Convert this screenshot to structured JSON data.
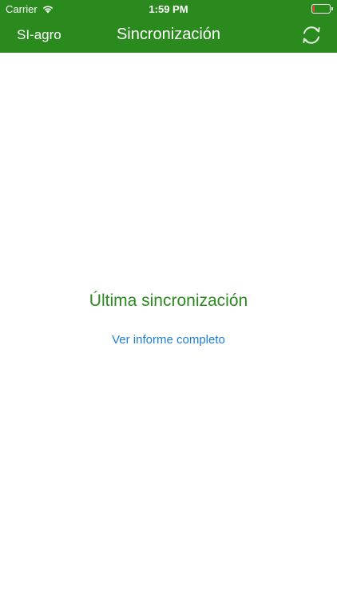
{
  "status_bar": {
    "carrier": "Carrier",
    "time": "1:59 PM",
    "battery_level_percent": 12,
    "wifi_icon": "wifi-icon",
    "battery_icon": "battery-icon"
  },
  "nav_bar": {
    "back_label": "SI-agro",
    "title": "Sincronización",
    "sync_icon": "refresh-icon"
  },
  "main": {
    "last_sync_label": "Última sincronización",
    "report_link_label": "Ver informe completo"
  },
  "colors": {
    "brand_green": "#2a8a1e",
    "link_blue": "#1e7fd6",
    "battery_low": "#ff3b30"
  }
}
